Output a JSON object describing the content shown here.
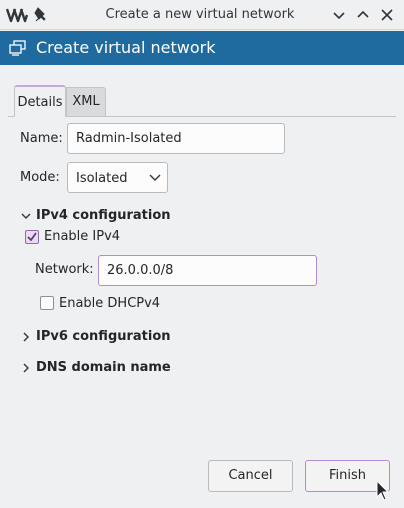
{
  "window": {
    "title": "Create a new virtual network"
  },
  "header": {
    "title": "Create virtual network"
  },
  "tabs": [
    {
      "label": "Details",
      "active": true
    },
    {
      "label": "XML",
      "active": false
    }
  ],
  "form": {
    "name_label": "Name:",
    "name_value": "Radmin-Isolated",
    "mode_label": "Mode:",
    "mode_value": "Isolated"
  },
  "ipv4": {
    "title": "IPv4 configuration",
    "expanded": true,
    "enable_label": "Enable IPv4",
    "enable_checked": true,
    "network_label": "Network:",
    "network_value": "26.0.0.0/8",
    "dhcp_label": "Enable DHCPv4",
    "dhcp_checked": false
  },
  "ipv6": {
    "title": "IPv6 configuration",
    "expanded": false
  },
  "dns": {
    "title": "DNS domain name",
    "expanded": false
  },
  "buttons": {
    "cancel": "Cancel",
    "finish": "Finish"
  },
  "colors": {
    "header_bg": "#1f6ba0",
    "accent": "#8e6aa7"
  }
}
